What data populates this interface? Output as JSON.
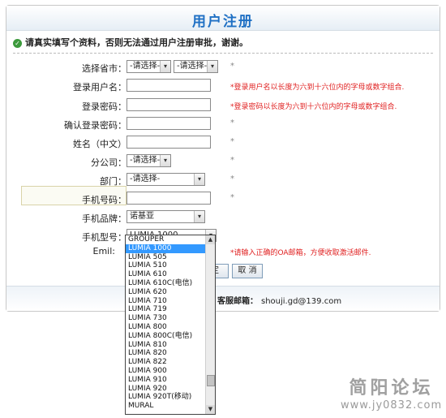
{
  "header": {
    "title": "用户注册"
  },
  "notice": "请真实填写个资料，否则无法通过用户注册审批，谢谢。",
  "form": {
    "province_label": "选择省市：",
    "province_value": "-请选择-",
    "city_value": "-请选择-",
    "username_label": "登录用户名：",
    "username_hint": "*登录用户名以长度为六到十六位内的字母或数字组合.",
    "password_label": "登录密码：",
    "password_hint": "*登录密码以长度为六到十六位内的字母或数字组合.",
    "confirm_label": "确认登录密码：",
    "name_label": "姓名（中文）",
    "branch_label": "分公司：",
    "branch_value": "-请选择-",
    "dept_label": "部门：",
    "dept_value": "-请选择-",
    "phone_label": "手机号码：",
    "brand_label": "手机品牌：",
    "brand_value": "诺基亚",
    "model_label": "手机型号：",
    "model_value": "LUMIA 1000",
    "email_label": "Emil:",
    "email_hint": "*请输入正确的OA邮箱，方便收取激活邮件.",
    "star": "*"
  },
  "buttons": {
    "submit_label": "定",
    "cancel_label": "取 消"
  },
  "footer": {
    "mail_label": "客服邮箱：",
    "mail_value": "shouji.gd@139.com"
  },
  "dropdown": {
    "options": [
      "GROUPER",
      "LUMIA 1000",
      "LUMIA 505",
      "LUMIA 510",
      "LUMIA 610",
      "LUMIA 610C(电信)",
      "LUMIA 620",
      "LUMIA 710",
      "LUMIA 719",
      "LUMIA 730",
      "LUMIA 800",
      "LUMIA 800C(电信)",
      "LUMIA 810",
      "LUMIA 820",
      "LUMIA 822",
      "LUMIA 900",
      "LUMIA 910",
      "LUMIA 920",
      "LUMIA 920T(移动)",
      "MURAL"
    ],
    "selected": "LUMIA 1000"
  },
  "watermark": {
    "line1": "简阳论坛",
    "line2": "www.jy0832.com"
  },
  "colors": {
    "title": "#1f70c4",
    "hint": "#e02020",
    "selected": "#3399ff"
  }
}
